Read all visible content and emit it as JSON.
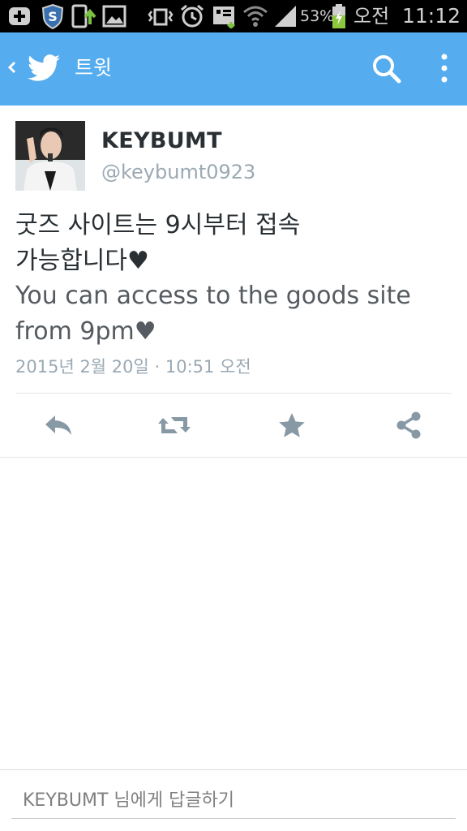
{
  "status_bar": {
    "battery_percent": "53%",
    "ampm": "오전",
    "time": "11:12",
    "icons": [
      "plus-badge-icon",
      "shield-s-icon",
      "phone-upload-icon",
      "image-icon",
      "vibrate-icon",
      "alarm-icon",
      "cast-icon",
      "wifi-icon",
      "signal-icon",
      "battery-charging-icon"
    ]
  },
  "app_bar": {
    "title": "트윗",
    "color": "#55acee",
    "icons": [
      "back-chevron-icon",
      "twitter-bird-icon",
      "search-icon",
      "overflow-menu-icon"
    ]
  },
  "tweet": {
    "display_name": "KEYBUMT",
    "handle": "@keybumt0923",
    "text_lines": [
      "굿즈 사이트는 9시부터 접속",
      "가능합니다♥",
      "You can access to the goods site",
      "from 9pm♥"
    ],
    "timestamp": "2015년 2월 20일 · 10:51 오전",
    "actions": [
      "reply-icon",
      "retweet-icon",
      "favorite-star-icon",
      "share-icon"
    ]
  },
  "reply_box": {
    "placeholder": "KEYBUMT 님에게 답글하기"
  }
}
